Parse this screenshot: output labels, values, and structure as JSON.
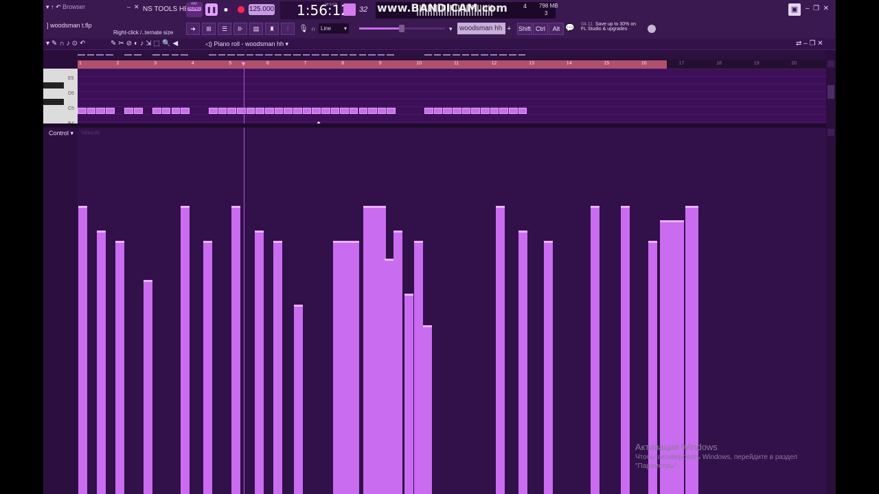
{
  "toolbar": {
    "browser_label": "Browser",
    "menu_fragment": "NS  TOOLS  HELP",
    "pat_label": "PAT",
    "song_label": "SONG",
    "tempo": "125.000",
    "time": "1:56:12",
    "time_unit": "M:S:CS",
    "snap_value": "32",
    "cpu_value": "4",
    "ram_value": "798 MB",
    "poly_value": "3",
    "file_name": "] woodsman t.flp",
    "hint_text": "Right-click /..ternate size",
    "draw_mode": "Line",
    "pattern_name": "woodsman hh",
    "shift_label": "Shift",
    "ctrl_label": "Ctrl",
    "alt_label": "Alt",
    "news_date": "04.11",
    "news_line1": "Save up to 30% on",
    "news_line2": "FL Studio & upgrades"
  },
  "piano_roll": {
    "title": "Piano roll - woodsman hh",
    "bar_numbers": [
      "1",
      "2",
      "3",
      "4",
      "5",
      "6",
      "7",
      "8",
      "9",
      "10",
      "11",
      "12",
      "13",
      "14",
      "15",
      "16",
      "17",
      "18",
      "19",
      "20"
    ],
    "key_labels": [
      "E5",
      "D5",
      "C5",
      "B4"
    ],
    "control_label": "Control",
    "control_target": "Velocity"
  },
  "notes": {
    "pitch": "C5",
    "steps": [
      0,
      1,
      2,
      3,
      5,
      6,
      8,
      9,
      10,
      11,
      14,
      15,
      16,
      17,
      18,
      19,
      20,
      21,
      22,
      23,
      24,
      25,
      26,
      27,
      28,
      29,
      30,
      31,
      32,
      33,
      37,
      38,
      39,
      40,
      41,
      42,
      43,
      44,
      45,
      46,
      47
    ]
  },
  "velocities": [
    0.78,
    0.71,
    0.68,
    0.57,
    0.78,
    0.68,
    0.78,
    0.71,
    0.68,
    0.5,
    0.68,
    0.68,
    0.68,
    0.68,
    0.78,
    0.78,
    0.78,
    0.78,
    0.63,
    0.71,
    0.53,
    0.68,
    0.44,
    0.78,
    0.71,
    0.68,
    0.78,
    0.78,
    0.68,
    0.74,
    0.74,
    0.74,
    0.78,
    0.78
  ],
  "velocity_steps": [
    0,
    4,
    8,
    14,
    22,
    27,
    33,
    38,
    42,
    46.5,
    55,
    56.2,
    57.4,
    58.6,
    61.5,
    62.5,
    63.5,
    64.5,
    66,
    68,
    70.3,
    72.5,
    74.3,
    90,
    95,
    100.5,
    110.5,
    117,
    123,
    125.5,
    127.2,
    128.8,
    131,
    131.8
  ],
  "watermark": "www.BANDICAM.com",
  "activation": {
    "line1": "Активация Windows",
    "line2": "Чтобы активировать Windows, перейдите в раздел",
    "line3": "\"Параметры\"."
  },
  "colors": {
    "accent": "#c96cf0",
    "ruler": "#b0506d",
    "background": "#32104a"
  }
}
